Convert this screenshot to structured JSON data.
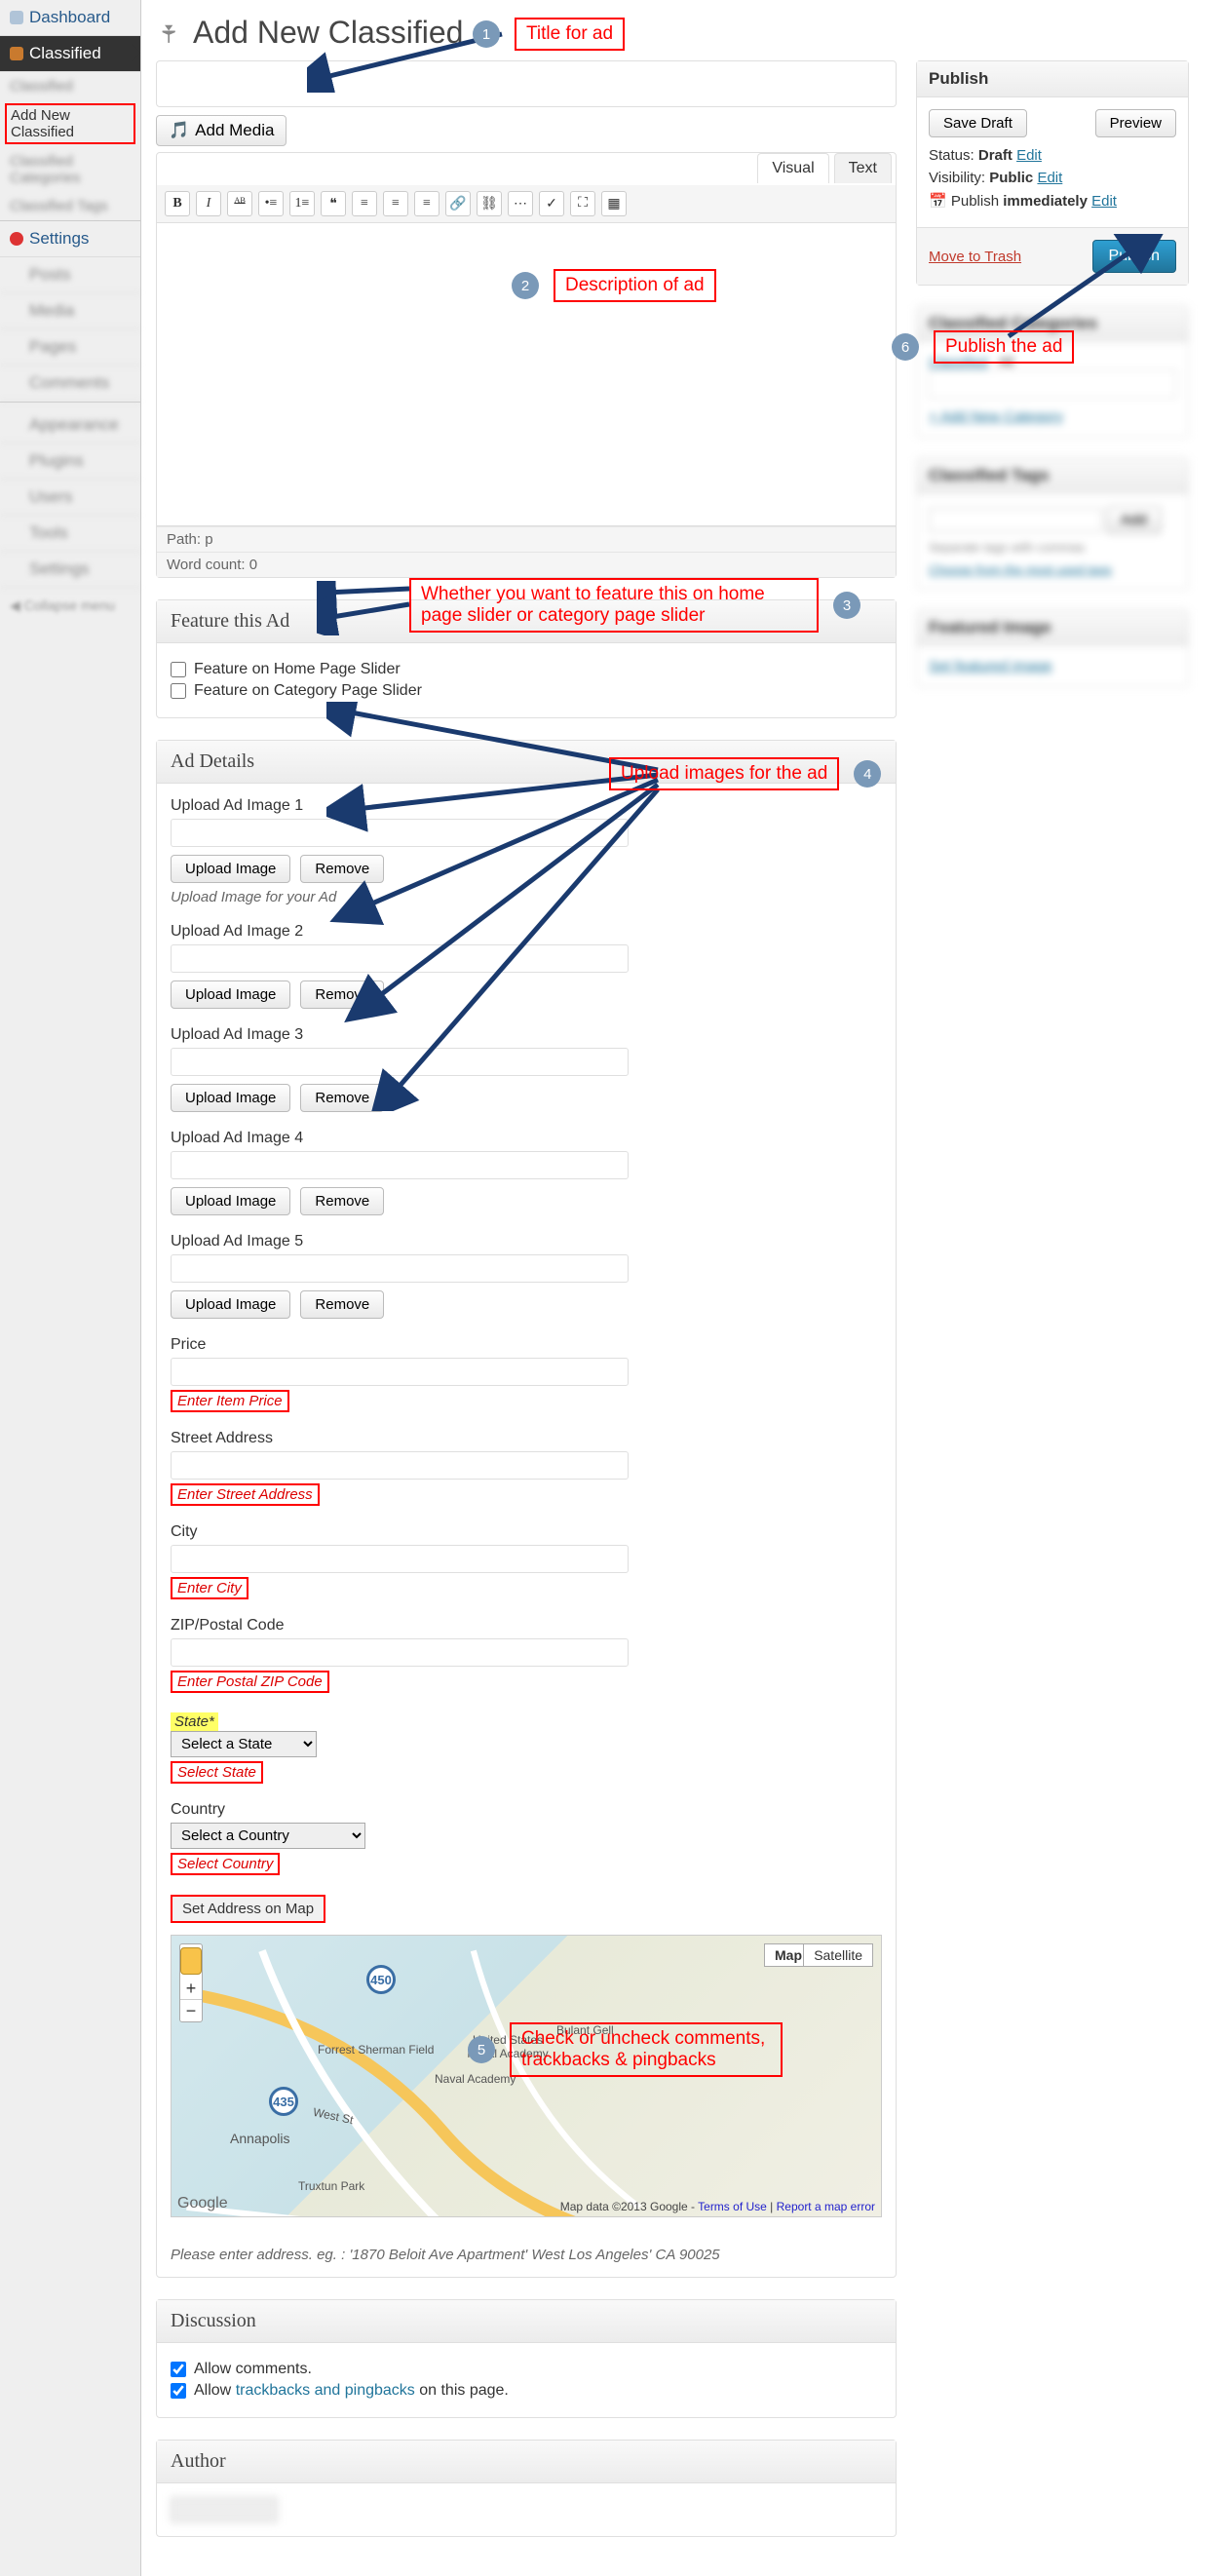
{
  "sidebar": {
    "dashboard": "Dashboard",
    "classified": "Classified",
    "sub_classified": "Classified",
    "sub_add_new": "Add New Classified",
    "sub_categories": "Classified Categories",
    "sub_tags": "Classified Tags",
    "settings": "Settings",
    "posts": "Posts",
    "media": "Media",
    "pages": "Pages",
    "comments": "Comments",
    "appearance": "Appearance",
    "plugins": "Plugins",
    "users": "Users",
    "tools": "Tools",
    "settings2": "Settings",
    "collapse": "Collapse menu"
  },
  "page": {
    "title": "Add New Classified"
  },
  "editor": {
    "add_media": "Add Media",
    "tab_visual": "Visual",
    "tab_text": "Text",
    "path_label": "Path: p",
    "word_count": "Word count: 0"
  },
  "feature_box": {
    "title": "Feature this Ad",
    "opt_home": "Feature on Home Page Slider",
    "opt_cat": "Feature on Category Page Slider"
  },
  "ad_details": {
    "title": "Ad Details",
    "upload1": "Upload Ad Image 1",
    "upload2": "Upload Ad Image 2",
    "upload3": "Upload Ad Image 3",
    "upload4": "Upload Ad Image 4",
    "upload5": "Upload Ad Image 5",
    "upload_btn": "Upload Image",
    "remove_btn": "Remove",
    "upload_helper": "Upload Image for your Ad",
    "price": "Price",
    "price_hint": "Enter Item Price",
    "street": "Street Address",
    "street_hint": "Enter Street Address",
    "city": "City",
    "city_hint": "Enter City",
    "zip": "ZIP/Postal Code",
    "zip_hint": "Enter Postal ZIP Code",
    "state": "State*",
    "state_sel": "Select a State",
    "state_hint": "Select State",
    "country": "Country",
    "country_sel": "Select a Country",
    "country_hint": "Select Country",
    "set_map": "Set Address on Map",
    "map_btn": "Map",
    "sat_btn": "Satellite",
    "map_credit_pre": "Map data ©2013 Google - ",
    "map_terms": "Terms of Use",
    "map_report": "Report a map error",
    "map_logo": "Google",
    "route450": "450",
    "route435": "435",
    "loc1": "Forrest Sherman Field",
    "loc2": "United States Naval Academy",
    "loc3": "Naval Academy",
    "loc4": "Annapolis",
    "loc5": "Truxtun Park",
    "loc_west": "West St",
    "loc_bg": "Bulant Gell",
    "address_example": "Please enter address. eg. : '1870 Beloit Ave Apartment' West Los Angeles' CA 90025"
  },
  "discussion": {
    "title": "Discussion",
    "allow_comments": "Allow comments.",
    "allow_pre": "Allow ",
    "trackbacks": "trackbacks and pingbacks",
    "allow_post": " on this page."
  },
  "author": {
    "title": "Author"
  },
  "publish": {
    "title": "Publish",
    "save_draft": "Save Draft",
    "preview": "Preview",
    "status_label": "Status:",
    "status_val": "Draft",
    "edit": "Edit",
    "visibility_label": "Visibility:",
    "visibility_val": "Public",
    "publish_label": "Publish",
    "publish_val": "immediately",
    "trash": "Move to Trash",
    "publish_btn": "Publish",
    "cat_title": "Classified Categories",
    "cat_tab1": "Classified",
    "cat_tab2": "All",
    "cat_add": "+ Add New Category",
    "tags_title": "Classified Tags",
    "tags_add": "Add",
    "tags_sep": "Separate tags with commas",
    "tags_choose": "Choose from the most used tags",
    "img_title": "Featured Image",
    "img_set": "Set featured image"
  },
  "annotations": {
    "a1": "Title for ad",
    "n1": "1",
    "a2": "Description of ad",
    "n2": "2",
    "a3": "Whether you want to feature this on home page slider or category page slider",
    "n3": "3",
    "a4": "Upload images for the ad",
    "n4": "4",
    "a5": "Check or uncheck comments, trackbacks & pingbacks",
    "n5": "5",
    "a6": "Publish the ad",
    "n6": "6"
  }
}
